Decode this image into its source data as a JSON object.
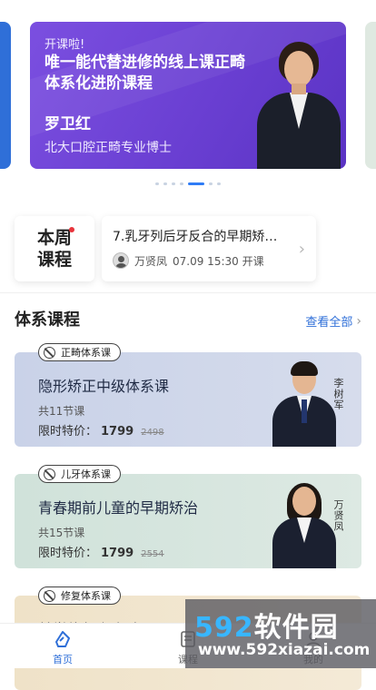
{
  "banner": {
    "tag": "开课啦!",
    "title": "唯一能代替进修的线上课正畸体系化进阶课程",
    "name": "罗卫红",
    "subtitle": "北大口腔正畸专业博士"
  },
  "this_week": {
    "badge_line1": "本周",
    "badge_line2": "课程",
    "title": "7.乳牙列后牙反合的早期矫…",
    "teacher": "万贤凤",
    "time": "07.09 15:30 开课"
  },
  "section": {
    "title": "体系课程",
    "view_all": "查看全部"
  },
  "courses": [
    {
      "tag": "正畸体系课",
      "title": "隐形矫正中级体系课",
      "lessons": "共11节课",
      "price_label": "限时特价：",
      "price": "1799",
      "old_price": "2498",
      "teacher": "李树军",
      "bg": "#cbd4e7"
    },
    {
      "tag": "儿牙体系课",
      "title": "青春期前儿童的早期矫治",
      "lessons": "共15节课",
      "price_label": "限时特价：",
      "price": "1799",
      "old_price": "2554",
      "teacher": "万贤凤",
      "bg": "#d3e3dc"
    },
    {
      "tag": "修复体系课",
      "title": "美学修复之瓷贴面",
      "bg": "#f1e6cf"
    }
  ],
  "tabbar": {
    "home": "首页",
    "course": "课程",
    "mine": "我的"
  },
  "watermark": {
    "big_prefix": "592",
    "big_suffix": "软件园",
    "url": "www.592xiazai.com"
  },
  "colors": {
    "accent": "#2f6fd8",
    "banner": "#6a3fd2",
    "red_dot": "#e8343b"
  }
}
